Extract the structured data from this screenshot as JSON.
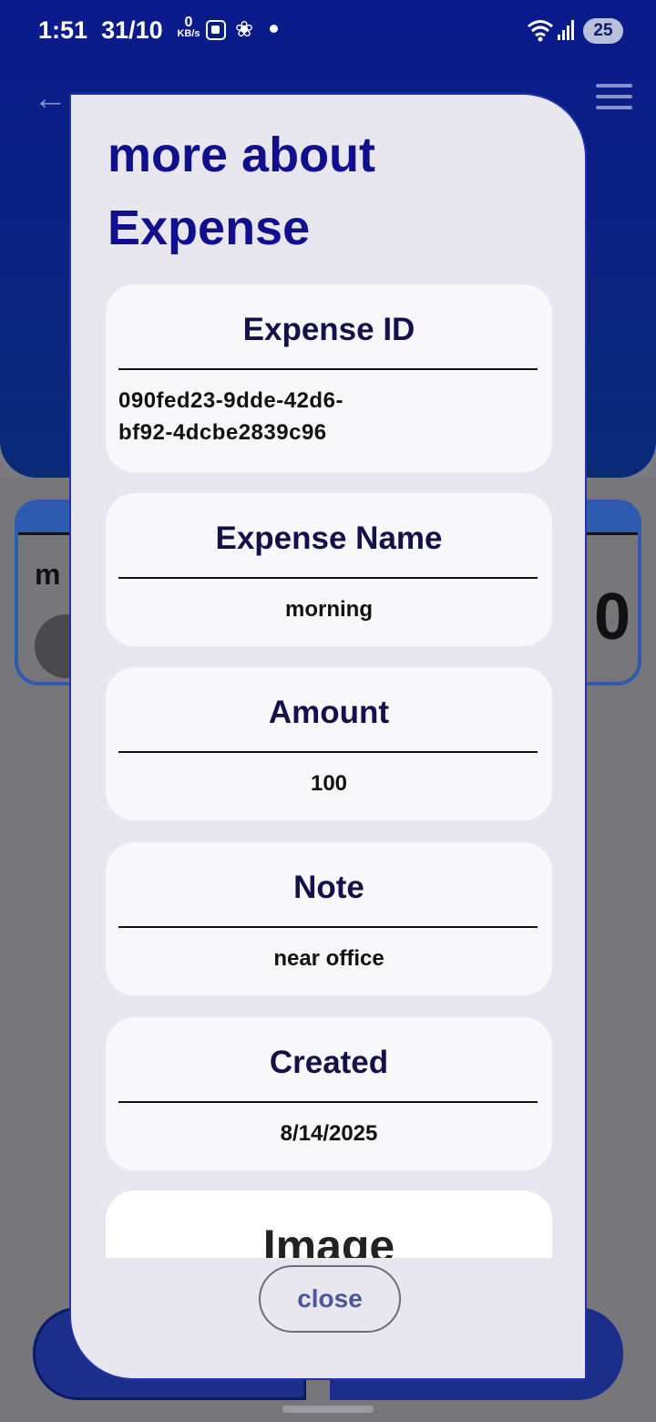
{
  "status_bar": {
    "time": "1:51",
    "date": "31/10",
    "net_speed_value": "0",
    "net_speed_unit": "KB/s",
    "battery": "25"
  },
  "background": {
    "card_name_partial": "m",
    "card_amount_partial": "0"
  },
  "modal": {
    "title": "more about Expense",
    "fields": [
      {
        "label": "Expense ID",
        "value": "090fed23-9dde-42d6-bf92-4dcbe2839c96"
      },
      {
        "label": "Expense Name",
        "value": "morning"
      },
      {
        "label": "Amount",
        "value": "100"
      },
      {
        "label": "Note",
        "value": "near office"
      },
      {
        "label": "Created",
        "value": "8/14/2025"
      },
      {
        "label": "Image",
        "value": ""
      }
    ],
    "close_label": "close"
  }
}
